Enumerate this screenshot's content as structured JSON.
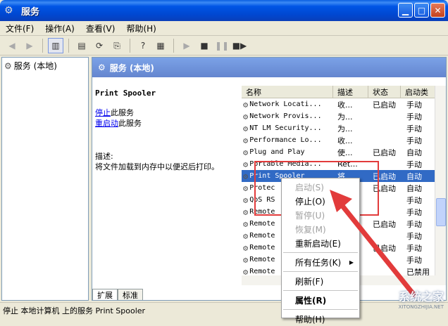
{
  "window": {
    "title": "服务"
  },
  "menu": [
    "文件(F)",
    "操作(A)",
    "查看(V)",
    "帮助(H)"
  ],
  "tree": {
    "root": "服务 (本地)"
  },
  "pane": {
    "header": "服务 (本地)",
    "service_name": "Print Spooler",
    "stop_link": "停止",
    "stop_suffix": "此服务",
    "restart_link": "重启动",
    "restart_suffix": "此服务",
    "desc_label": "描述:",
    "desc_text": "将文件加载到内存中以便迟后打印。"
  },
  "columns": [
    "名称",
    "描述",
    "状态",
    "启动类"
  ],
  "rows": [
    {
      "name": "Network Locati...",
      "desc": "收...",
      "status": "已启动",
      "start": "手动"
    },
    {
      "name": "Network Provis...",
      "desc": "为...",
      "status": "",
      "start": "手动"
    },
    {
      "name": "NT LM Security...",
      "desc": "为...",
      "status": "",
      "start": "手动"
    },
    {
      "name": "Performance Lo...",
      "desc": "收...",
      "status": "",
      "start": "手动"
    },
    {
      "name": "Plug and Play",
      "desc": "使...",
      "status": "已启动",
      "start": "自动"
    },
    {
      "name": "Portable Media...",
      "desc": "Ret...",
      "status": "",
      "start": "手动"
    },
    {
      "name": "Print Spooler",
      "desc": "将...",
      "status": "已启动",
      "start": "自动"
    },
    {
      "name": "Protec",
      "desc": "",
      "status": "已启动",
      "start": "自动"
    },
    {
      "name": "QoS RS",
      "desc": "",
      "status": "",
      "start": "手动"
    },
    {
      "name": "Remote",
      "desc": "",
      "status": "",
      "start": "手动"
    },
    {
      "name": "Remote",
      "desc": "",
      "status": "已启动",
      "start": "手动"
    },
    {
      "name": "Remote",
      "desc": "",
      "status": "",
      "start": "手动"
    },
    {
      "name": "Remote",
      "desc": "",
      "status": "已启动",
      "start": "手动"
    },
    {
      "name": "Remote",
      "desc": "",
      "status": "",
      "start": "手动"
    },
    {
      "name": "Remote",
      "desc": "",
      "status": "",
      "start": "已禁用"
    }
  ],
  "tabs": [
    "扩展",
    "标准"
  ],
  "status_bar": "停止 本地计算机 上的服务 Print Spooler",
  "context_menu": {
    "start": "启动(S)",
    "stop": "停止(O)",
    "pause": "暂停(U)",
    "resume": "恢复(M)",
    "restart": "重新启动(E)",
    "all_tasks": "所有任务(K)",
    "refresh": "刷新(F)",
    "properties": "属性(R)",
    "help": "帮助(H)"
  },
  "watermark": {
    "main": "系统之家",
    "sub": "XITONGZHIJIA.NET"
  },
  "colors": {
    "title_bar": "#0055e5",
    "selection": "#316ac5",
    "annotation": "#e23b3b"
  }
}
